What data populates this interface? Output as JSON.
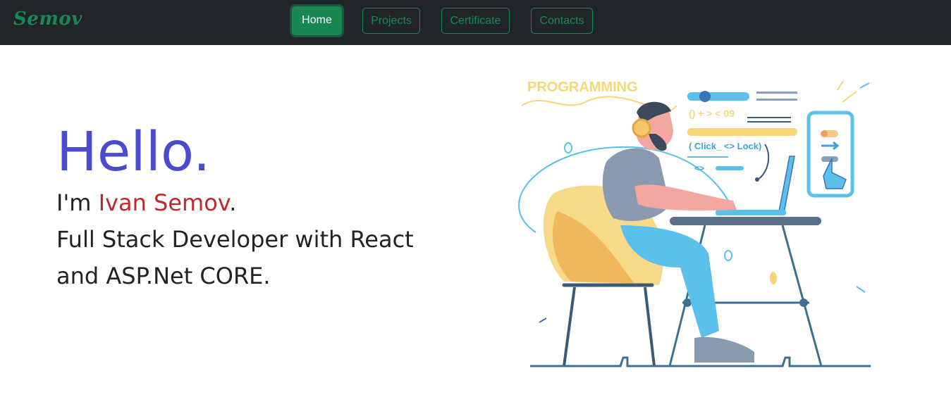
{
  "brand": {
    "name": "Semov"
  },
  "nav": {
    "home": "Home",
    "projects": "Projects",
    "certificate": "Certificate",
    "contacts": "Contacts"
  },
  "hero": {
    "greeting": "Hello.",
    "intro_prefix": "I'm ",
    "name": "Ivan Semov",
    "intro_suffix": ".",
    "role_line1": "Full Stack Developer with React",
    "role_line2": "and ASP.Net CORE."
  },
  "illustration": {
    "title": "PROGRAMMING",
    "code_line1": "() + > < 09",
    "code_line2": "( Click_ <> Lock)",
    "code_line3": "<>"
  },
  "colors": {
    "navbar_bg": "#212529",
    "accent_green": "#198754",
    "hello": "#4b4bd0",
    "name_highlight": "#c0282e"
  }
}
